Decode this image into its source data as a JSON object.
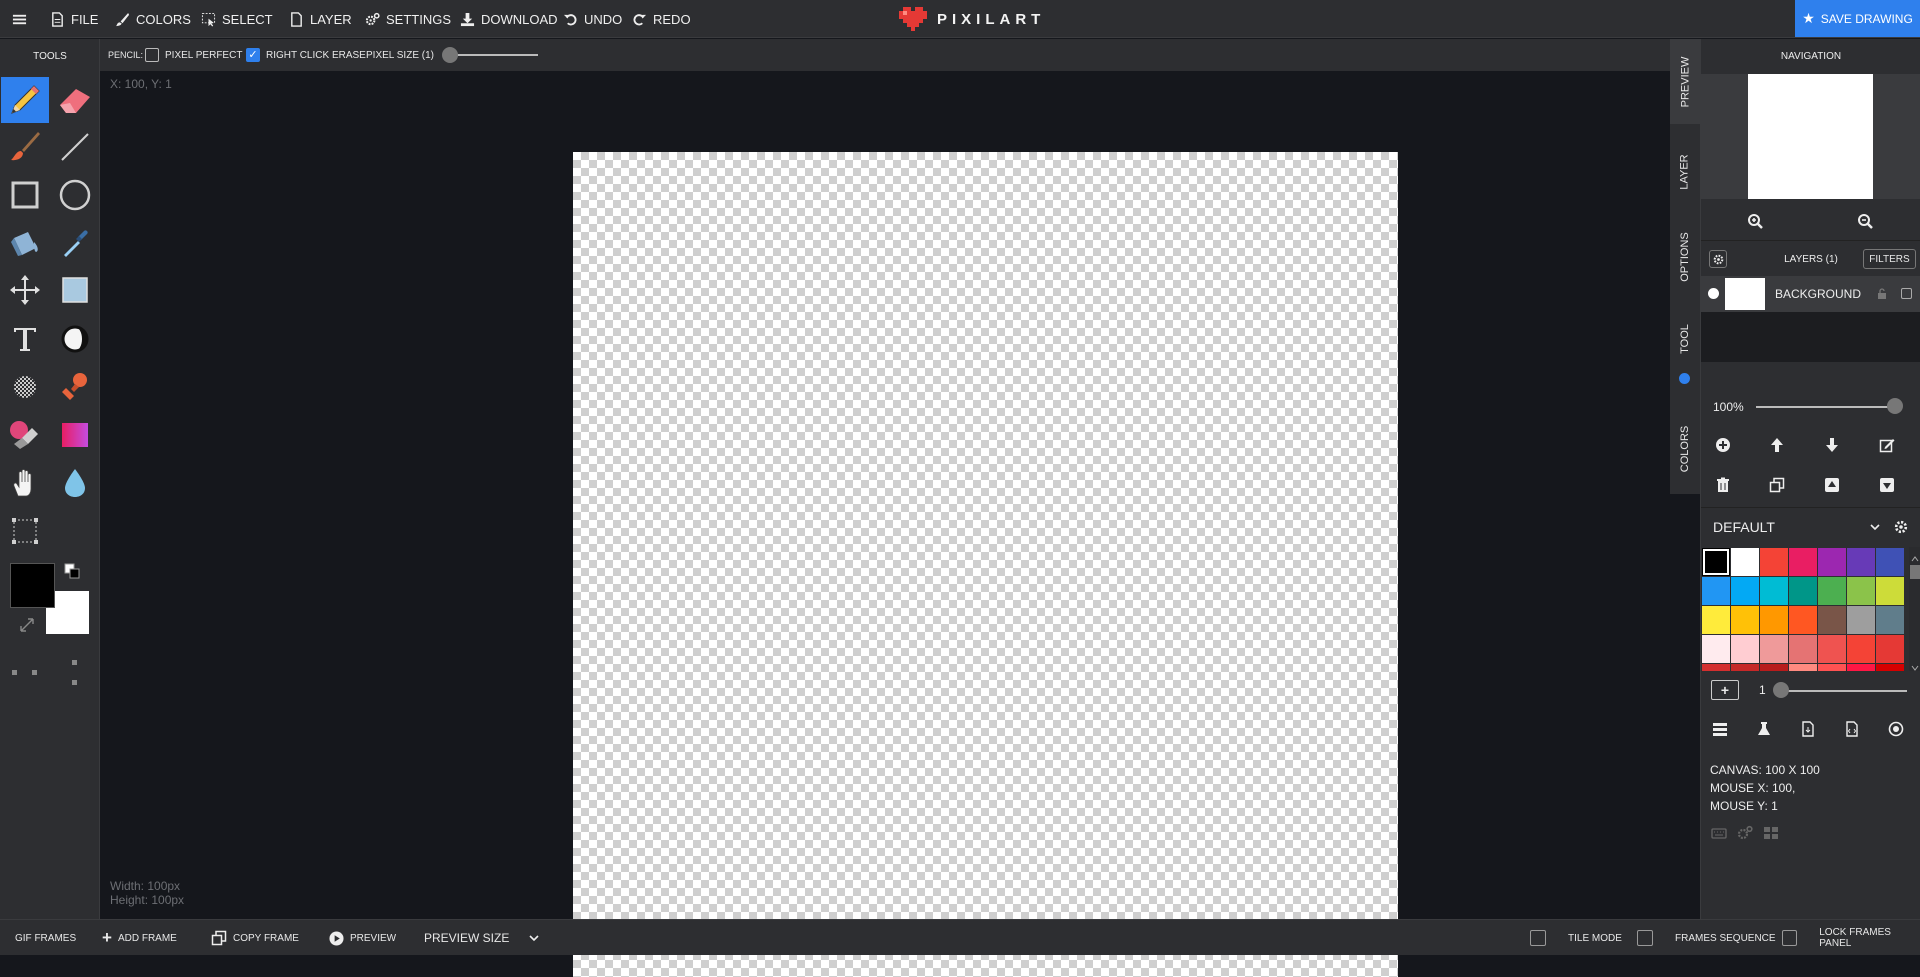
{
  "topbar": {
    "menu_items": [
      "FILE",
      "COLORS",
      "SELECT",
      "LAYER",
      "SETTINGS",
      "DOWNLOAD",
      "UNDO",
      "REDO"
    ],
    "logo_text": "PIXILART",
    "save_label": "SAVE DRAWING"
  },
  "optbar": {
    "tool_label": "PENCIL:",
    "pixel_perfect": "PIXEL PERFECT",
    "pixel_perfect_checked": false,
    "right_click_erase": "RIGHT CLICK ERASE",
    "right_click_erase_checked": true,
    "pixel_size": "PIXEL SIZE (1)"
  },
  "tools": {
    "title": "TOOLS",
    "primary_color": "#000000",
    "secondary_color": "#ffffff"
  },
  "workspace": {
    "coords": "X: 100, Y: 1",
    "width_text": "Width: 100px",
    "height_text": "Height: 100px"
  },
  "righttabs": [
    "PREVIEW",
    "LAYER",
    "OPTIONS",
    "TOOL",
    "COLORS"
  ],
  "navigation": {
    "title": "NAVIGATION"
  },
  "layers": {
    "title": "LAYERS (1)",
    "filters_label": "FILTERS",
    "items": [
      {
        "name": "BACKGROUND"
      }
    ],
    "opacity": "100%"
  },
  "palette": {
    "name": "DEFAULT",
    "colors": [
      "#000000",
      "#ffffff",
      "#f44336",
      "#e91e63",
      "#9c27b0",
      "#673ab7",
      "#3f51b5",
      "#2196f3",
      "#03a9f4",
      "#00bcd4",
      "#009688",
      "#4caf50",
      "#8bc34a",
      "#cddc39",
      "#ffeb3b",
      "#ffc107",
      "#ff9800",
      "#ff5722",
      "#795548",
      "#9e9e9e",
      "#607d8b",
      "#ffebee",
      "#ffcdd2",
      "#ef9a9a",
      "#e57373",
      "#ef5350",
      "#f44336",
      "#e53935",
      "#d32f2f",
      "#c62828",
      "#b71c1c",
      "#ff8a80",
      "#ff5252",
      "#ff1744",
      "#d50000"
    ],
    "brush_count": "1"
  },
  "canvas_info": {
    "size": "CANVAS: 100 X 100",
    "mouse_x": "MOUSE X: 100,",
    "mouse_y": "MOUSE Y: 1"
  },
  "bottombar": {
    "gif_frames": "GIF FRAMES",
    "add_frame": "ADD FRAME",
    "copy_frame": "COPY FRAME",
    "preview": "PREVIEW",
    "preview_size": "PREVIEW SIZE",
    "tile_mode": "TILE MODE",
    "frames_sequence": "FRAMES SEQUENCE",
    "lock_frames_panel": "LOCK FRAMES PANEL"
  },
  "colors": {
    "accent": "#2f80ed",
    "panel": "#2d2e31",
    "workspace": "#15171c"
  }
}
